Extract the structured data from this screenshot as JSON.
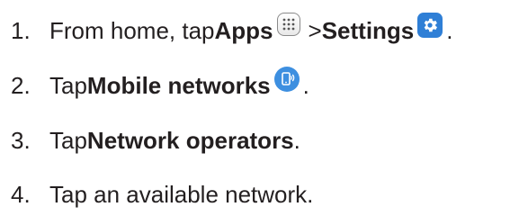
{
  "steps": [
    {
      "number": "1.",
      "parts": [
        "From home, tap ",
        "Apps",
        " > ",
        "Settings",
        "."
      ]
    },
    {
      "number": "2.",
      "parts": [
        "Tap ",
        "Mobile networks",
        "."
      ]
    },
    {
      "number": "3.",
      "parts": [
        "Tap ",
        "Network operators",
        "."
      ]
    },
    {
      "number": "4.",
      "parts": [
        "Tap an available network."
      ]
    }
  ],
  "icons": {
    "apps": "apps-grid-icon",
    "settings": "settings-gear-icon",
    "mobile_networks": "mobile-networks-icon"
  },
  "colors": {
    "text": "#231f20",
    "icon_blue": "#2f7fd6",
    "icon_light_blue": "#3d8fe0"
  }
}
